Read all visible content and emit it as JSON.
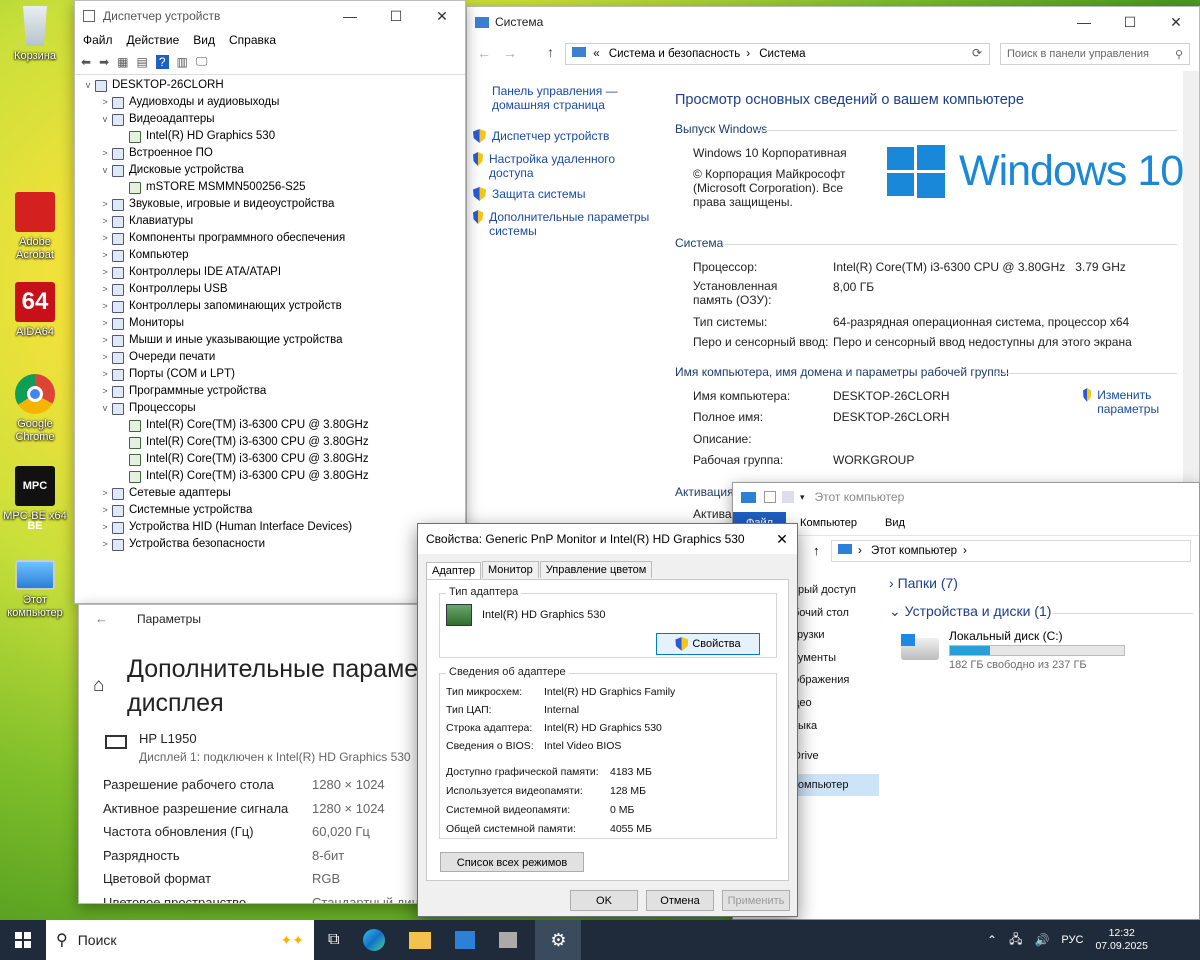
{
  "desktop": {
    "icons": [
      "Корзина",
      "Adobe Acrobat",
      "AIDA64",
      "Google Chrome",
      "MPC-BE x64",
      "Этот компьютер"
    ],
    "aida_label": "64",
    "mpc_label": "MPC BE"
  },
  "devmgr": {
    "title": "Диспетчер устройств",
    "menu": [
      "Файл",
      "Действие",
      "Вид",
      "Справка"
    ],
    "root": "DESKTOP-26CLORH",
    "items": [
      {
        "t": "Аудиовходы и аудиовыходы",
        "lvl": 1,
        "exp": ">"
      },
      {
        "t": "Видеоадаптеры",
        "lvl": 1,
        "exp": "v"
      },
      {
        "t": "Intel(R) HD Graphics 530",
        "lvl": 2,
        "exp": ""
      },
      {
        "t": "Встроенное ПО",
        "lvl": 1,
        "exp": ">"
      },
      {
        "t": "Дисковые устройства",
        "lvl": 1,
        "exp": "v"
      },
      {
        "t": "mSTORE MSMMN500256-S25",
        "lvl": 2,
        "exp": ""
      },
      {
        "t": "Звуковые, игровые и видеоустройства",
        "lvl": 1,
        "exp": ">"
      },
      {
        "t": "Клавиатуры",
        "lvl": 1,
        "exp": ">"
      },
      {
        "t": "Компоненты программного обеспечения",
        "lvl": 1,
        "exp": ">"
      },
      {
        "t": "Компьютер",
        "lvl": 1,
        "exp": ">"
      },
      {
        "t": "Контроллеры IDE ATA/ATAPI",
        "lvl": 1,
        "exp": ">"
      },
      {
        "t": "Контроллеры USB",
        "lvl": 1,
        "exp": ">"
      },
      {
        "t": "Контроллеры запоминающих устройств",
        "lvl": 1,
        "exp": ">"
      },
      {
        "t": "Мониторы",
        "lvl": 1,
        "exp": ">"
      },
      {
        "t": "Мыши и иные указывающие устройства",
        "lvl": 1,
        "exp": ">"
      },
      {
        "t": "Очереди печати",
        "lvl": 1,
        "exp": ">"
      },
      {
        "t": "Порты (COM и LPT)",
        "lvl": 1,
        "exp": ">"
      },
      {
        "t": "Программные устройства",
        "lvl": 1,
        "exp": ">"
      },
      {
        "t": "Процессоры",
        "lvl": 1,
        "exp": "v"
      },
      {
        "t": "Intel(R) Core(TM) i3-6300 CPU @ 3.80GHz",
        "lvl": 2,
        "exp": ""
      },
      {
        "t": "Intel(R) Core(TM) i3-6300 CPU @ 3.80GHz",
        "lvl": 2,
        "exp": ""
      },
      {
        "t": "Intel(R) Core(TM) i3-6300 CPU @ 3.80GHz",
        "lvl": 2,
        "exp": ""
      },
      {
        "t": "Intel(R) Core(TM) i3-6300 CPU @ 3.80GHz",
        "lvl": 2,
        "exp": ""
      },
      {
        "t": "Сетевые адаптеры",
        "lvl": 1,
        "exp": ">"
      },
      {
        "t": "Системные устройства",
        "lvl": 1,
        "exp": ">"
      },
      {
        "t": "Устройства HID (Human Interface Devices)",
        "lvl": 1,
        "exp": ">"
      },
      {
        "t": "Устройства безопасности",
        "lvl": 1,
        "exp": ">"
      }
    ]
  },
  "system": {
    "title": "Система",
    "breadcrumb_sep": "«",
    "crumb1": "Система и безопасность",
    "crumb2": "Система",
    "search_placeholder": "Поиск в панели управления",
    "home_link": "Панель управления — домашняя страница",
    "links": [
      "Диспетчер устройств",
      "Настройка удаленного доступа",
      "Защита системы",
      "Дополнительные параметры системы"
    ],
    "heading": "Просмотр основных сведений о вашем компьютере",
    "edition_h": "Выпуск Windows",
    "edition": "Windows 10 Корпоративная",
    "copyright": "© Корпорация Майкрософт (Microsoft Corporation). Все права защищены.",
    "logo_text": "Windows 10",
    "system_h": "Система",
    "cpu_k": "Процессор:",
    "cpu_v": "Intel(R) Core(TM) i3-6300 CPU @ 3.80GHz   3.79 GHz",
    "ram_k": "Установленная память (ОЗУ):",
    "ram_v": "8,00 ГБ",
    "type_k": "Тип системы:",
    "type_v": "64-разрядная операционная система, процессор x64",
    "pen_k": "Перо и сенсорный ввод:",
    "pen_v": "Перо и сенсорный ввод недоступны для этого экрана",
    "name_h": "Имя компьютера, имя домена и параметры рабочей группы",
    "cn_k": "Имя компьютера:",
    "cn_v": "DESKTOP-26CLORH",
    "fn_k": "Полное имя:",
    "fn_v": "DESKTOP-26CLORH",
    "desc_k": "Описание:",
    "wg_k": "Рабочая группа:",
    "wg_v": "WORKGROUP",
    "change": "Изменить параметры",
    "act1": "Активация",
    "act2": "Активация"
  },
  "explorer": {
    "title": "Этот компьютер",
    "tabs": [
      "Файл",
      "Компьютер",
      "Вид"
    ],
    "path": "Этот компьютер",
    "left": [
      "трый доступ",
      "бочий стол",
      "грузки",
      "кументы",
      "ображения",
      "део",
      "зыка",
      "Drive",
      "компьютер"
    ],
    "folders": "Папки (7)",
    "devices": "Устройства и диски (1)",
    "drive": "Локальный диск (C:)",
    "free": "182 ГБ свободно из 237 ГБ",
    "used_fraction": 0.23
  },
  "props": {
    "title": "Свойства: Generic PnP Monitor и Intel(R) HD Graphics 530",
    "tabs": [
      "Адаптер",
      "Монитор",
      "Управление цветом"
    ],
    "type_h": "Тип адаптера",
    "adapter": "Intel(R) HD Graphics 530",
    "props_btn": "Свойства",
    "info_h": "Сведения об адаптере",
    "rows": [
      [
        "Тип микросхем:",
        "Intel(R) HD Graphics Family"
      ],
      [
        "Тип ЦАП:",
        "Internal"
      ],
      [
        "Строка адаптера:",
        "Intel(R) HD Graphics 530"
      ],
      [
        "Сведения о BIOS:",
        "Intel Video BIOS"
      ]
    ],
    "mem": [
      [
        "Доступно графической памяти:",
        "4183 МБ"
      ],
      [
        "Используется видеопамяти:",
        "128 МБ"
      ],
      [
        "Системной видеопамяти:",
        "0 МБ"
      ],
      [
        "Общей системной памяти:",
        "4055 МБ"
      ]
    ],
    "list_btn": "Список всех режимов",
    "ok": "OK",
    "cancel": "Отмена",
    "apply": "Применить"
  },
  "settings": {
    "title": "Параметры",
    "heading1": "Дополнительные параме",
    "heading2": "дисплея",
    "monitor": "HP L1950",
    "monitor_sub": "Дисплей 1: подключен к Intel(R) HD Graphics 530",
    "rows": [
      [
        "Разрешение рабочего стола",
        "1280 × 1024"
      ],
      [
        "Активное разрешение сигнала",
        "1280 × 1024"
      ],
      [
        "Частота обновления (Гц)",
        "60,020 Гц"
      ],
      [
        "Разрядность",
        "8-бит"
      ],
      [
        "Цветовой формат",
        "RGB"
      ],
      [
        "Цветовое пространство",
        "Стандартный дин"
      ]
    ]
  },
  "taskbar": {
    "search": "Поиск",
    "lang": "РУС",
    "time": "12:32",
    "date": "07.09.2025"
  }
}
